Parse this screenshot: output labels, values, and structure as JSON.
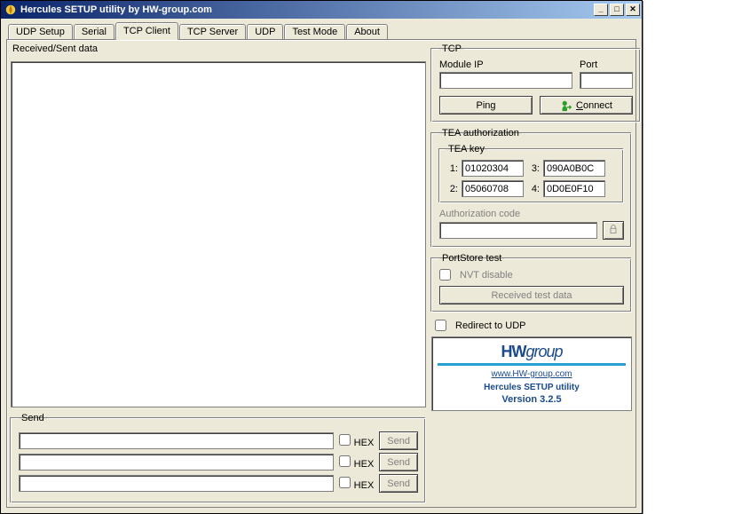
{
  "window": {
    "title": "Hercules SETUP utility by HW-group.com"
  },
  "tabs": [
    "UDP Setup",
    "Serial",
    "TCP Client",
    "TCP Server",
    "UDP",
    "Test Mode",
    "About"
  ],
  "active_tab": "TCP Client",
  "received": {
    "legend": "Received/Sent data",
    "value": ""
  },
  "tcp": {
    "legend": "TCP",
    "module_ip_label": "Module IP",
    "module_ip_value": "",
    "port_label": "Port",
    "port_value": "",
    "ping_label": "Ping",
    "connect_label": "Connect"
  },
  "tea": {
    "legend": "TEA authorization",
    "key_legend": "TEA key",
    "k1_label": "1:",
    "k1_value": "01020304",
    "k2_label": "2:",
    "k2_value": "05060708",
    "k3_label": "3:",
    "k3_value": "090A0B0C",
    "k4_label": "4:",
    "k4_value": "0D0E0F10",
    "authcode_label": "Authorization code",
    "authcode_value": ""
  },
  "portstore": {
    "legend": "PortStore test",
    "nvt_label": "NVT disable",
    "nvt_checked": false,
    "recv_label": "Received test data"
  },
  "redirect": {
    "label": "Redirect to UDP",
    "checked": false
  },
  "send": {
    "legend": "Send",
    "hex_label": "HEX",
    "button_label": "Send",
    "rows": [
      {
        "value": "",
        "hex": false
      },
      {
        "value": "",
        "hex": false
      },
      {
        "value": "",
        "hex": false
      }
    ]
  },
  "logo": {
    "brand": "HW",
    "brand2": "group",
    "url": "www.HW-group.com",
    "line1": "Hercules SETUP utility",
    "version": "Version  3.2.5"
  }
}
